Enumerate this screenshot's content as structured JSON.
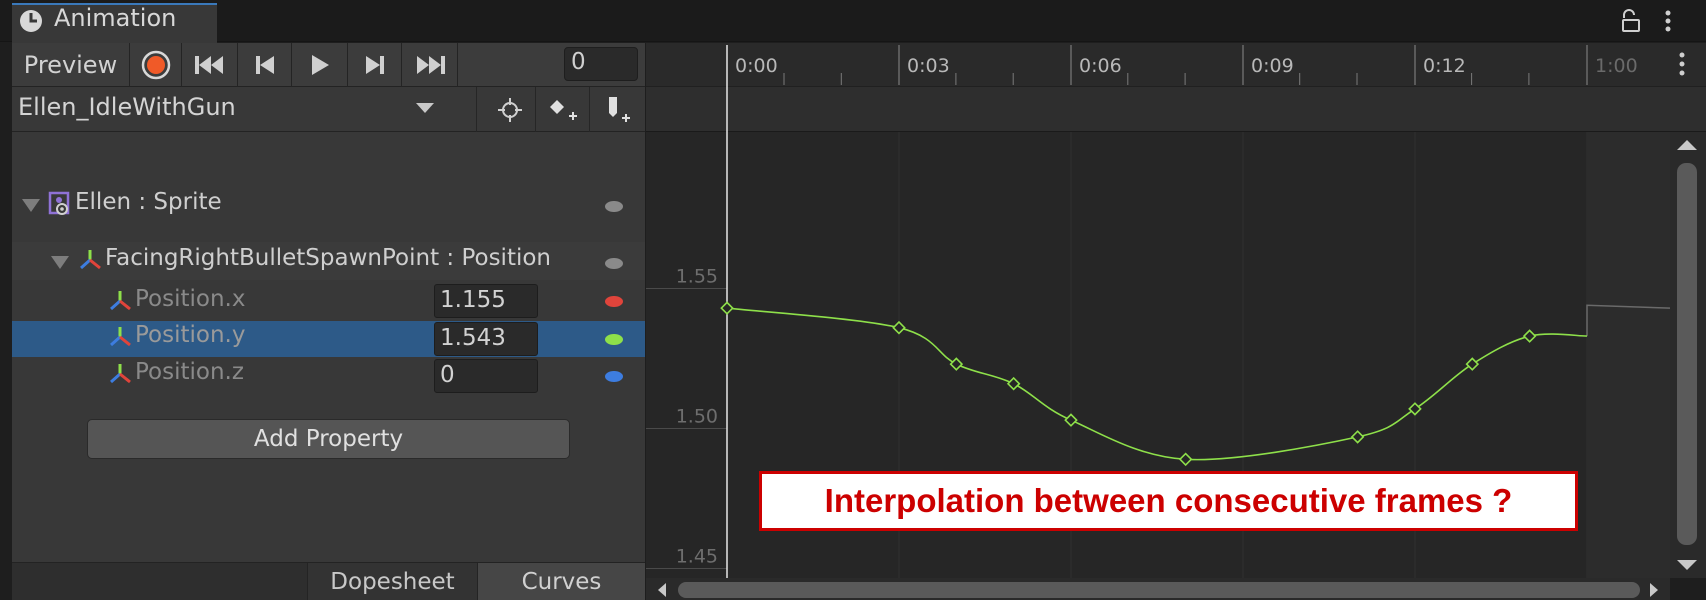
{
  "window": {
    "tab_title": "Animation"
  },
  "toolbar": {
    "preview_label": "Preview",
    "frame_value": "0",
    "record_color": "#f05a28"
  },
  "clip": {
    "name": "Ellen_IdleWithGun"
  },
  "hierarchy": {
    "root": {
      "label": "Ellen : Sprite"
    },
    "group": {
      "label": "FacingRightBulletSpawnPoint : Position"
    },
    "properties": [
      {
        "label": "Position.x",
        "value": "1.155",
        "color": "#e0443b"
      },
      {
        "label": "Position.y",
        "value": "1.543",
        "color": "#8ee04a",
        "selected": true
      },
      {
        "label": "Position.z",
        "value": "0",
        "color": "#3d7de0"
      }
    ]
  },
  "add_property_label": "Add Property",
  "bottom_tabs": {
    "dopesheet": "Dopesheet",
    "curves": "Curves"
  },
  "timeline": {
    "ruler_labels": [
      "0:00",
      "0:03",
      "0:06",
      "0:09",
      "0:12",
      "1:00"
    ],
    "y_labels": [
      "1.55",
      "1.50",
      "1.45"
    ],
    "curve_color": "#8ee04a"
  },
  "callout_text": "Interpolation between consecutive frames ?",
  "chart_data": {
    "type": "line",
    "series": [
      {
        "x": [
          0,
          3,
          4,
          5,
          6,
          8,
          11,
          12,
          13,
          14,
          15
        ],
        "y": [
          1.543,
          1.536,
          1.523,
          1.516,
          1.503,
          1.489,
          1.497,
          1.507,
          1.523,
          1.533,
          1.533
        ]
      }
    ],
    "ylim": [
      1.44,
      1.57
    ]
  }
}
